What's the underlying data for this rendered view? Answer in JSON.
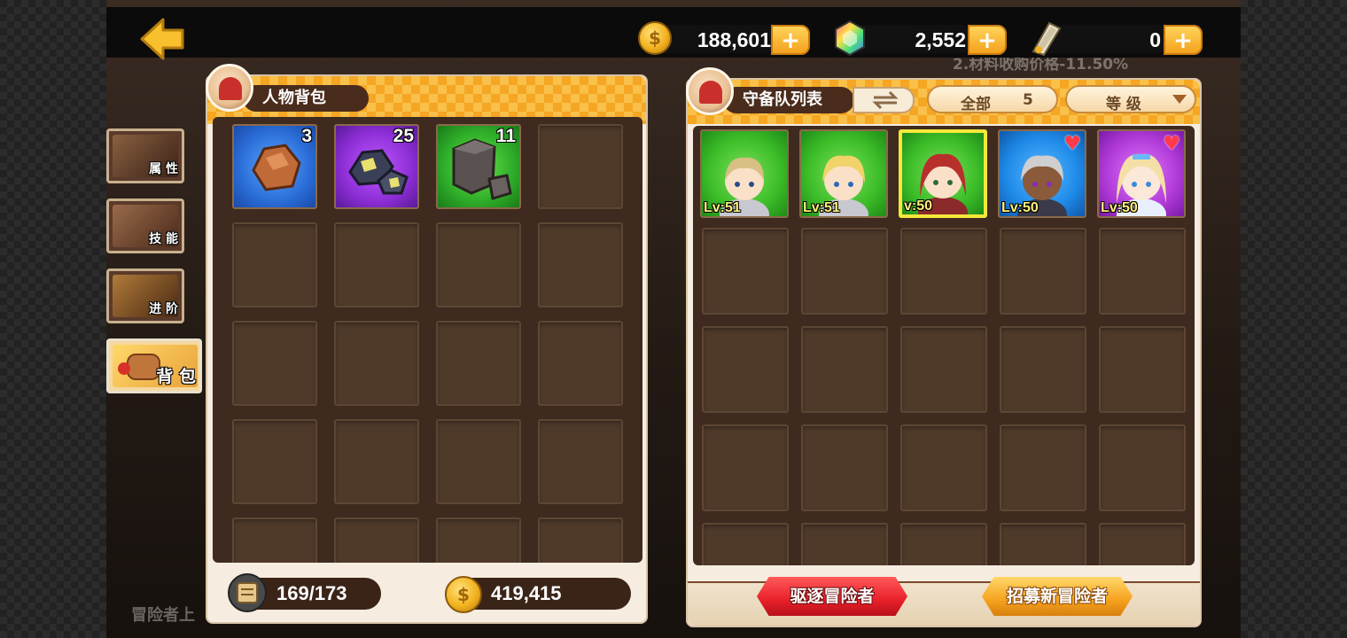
{
  "currencies": {
    "gold": "188,601",
    "gems": "2,552",
    "tickets": "0",
    "plus_label": "+"
  },
  "side_tabs": [
    {
      "label": "属 性"
    },
    {
      "label": "技 能"
    },
    {
      "label": "进 阶"
    },
    {
      "label": "背 包"
    }
  ],
  "inventory": {
    "title": "人物背包",
    "items": [
      {
        "name": "copper-ore",
        "count": "3",
        "bg": "#2b6ed8"
      },
      {
        "name": "silver-ore",
        "count": "25",
        "bg": "#8d2ed6"
      },
      {
        "name": "stone-block",
        "count": "11",
        "bg": "#2fae2a"
      }
    ],
    "capacity": "169/173",
    "gold": "419,415"
  },
  "roster": {
    "title": "守备队列表",
    "filter_label": "全部",
    "filter_count": "5",
    "sort_label": "等 级",
    "heroes": [
      {
        "level": "Lv:51",
        "bg": "#3cbd28",
        "hair": "#d8c084",
        "favorite": false,
        "selected": false
      },
      {
        "level": "Lv:51",
        "bg": "#3cbd28",
        "hair": "#f0d46a",
        "favorite": false,
        "selected": false
      },
      {
        "level": "v:50",
        "bg": "#3cbd28",
        "hair": "#b8302c",
        "favorite": false,
        "selected": true
      },
      {
        "level": "Lv:50",
        "bg": "#1e8ae8",
        "hair": "#cfcfcf",
        "favorite": true,
        "selected": false
      },
      {
        "level": "Lv:50",
        "bg": "#b13ad8",
        "hair": "#f4e0a6",
        "favorite": true,
        "selected": false
      }
    ],
    "dismiss_label": "驱逐冒险者",
    "recruit_label": "招募新冒险者"
  },
  "background": {
    "notice_line": "2.材料收购价格-11.50%",
    "footer_text": "冒险者上"
  },
  "colors": {
    "accent_orange": "#f5a623",
    "panel_cream": "#f6ece0",
    "slot_brown": "#4f3a2a",
    "dismiss_red": "#e8202a",
    "recruit_orange": "#f6a21e"
  }
}
